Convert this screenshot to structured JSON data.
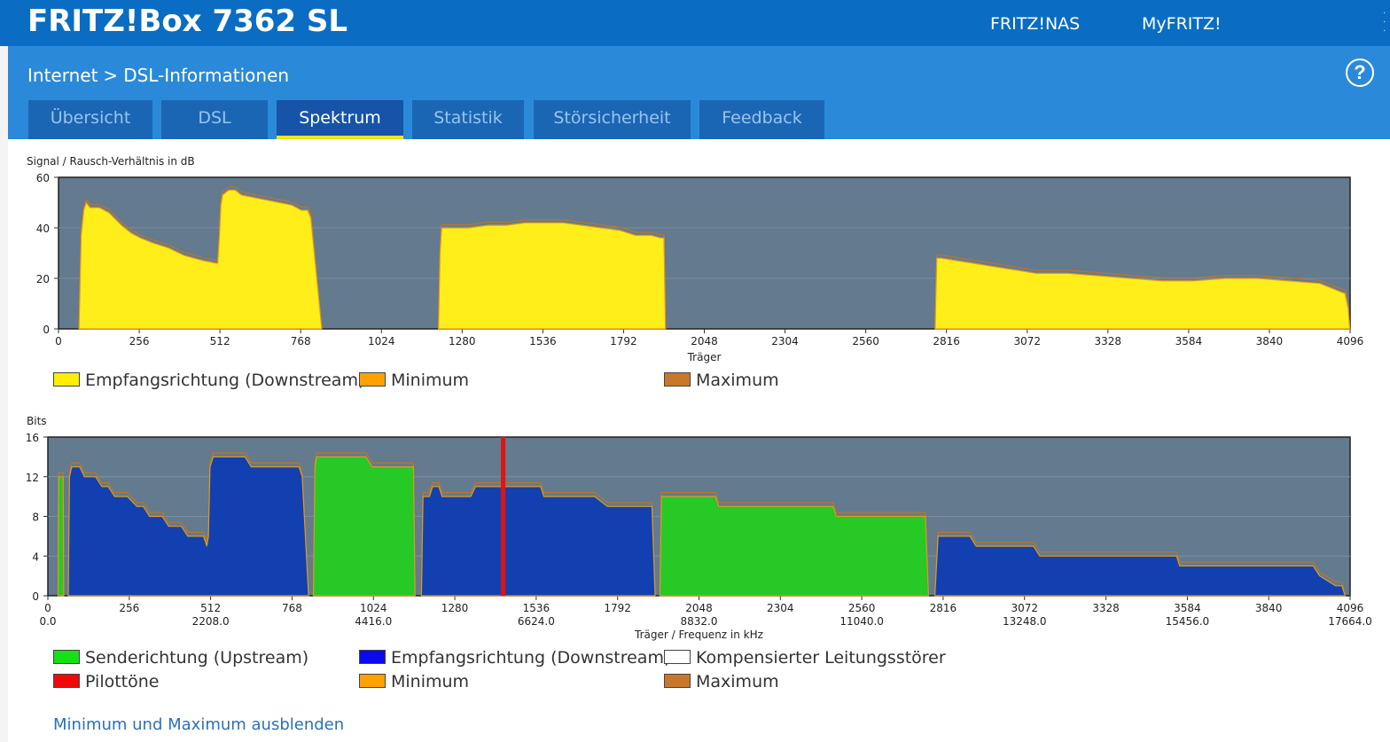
{
  "header": {
    "title": "FRITZ!Box 7362 SL",
    "links": [
      "FRITZ!NAS",
      "MyFRITZ!"
    ]
  },
  "breadcrumb": {
    "parent": "Internet",
    "separator": ">",
    "current": "DSL-Informationen"
  },
  "help": {
    "label": "?"
  },
  "tabs": [
    {
      "label": "Übersicht",
      "active": false
    },
    {
      "label": "DSL",
      "active": false
    },
    {
      "label": "Spektrum",
      "active": true
    },
    {
      "label": "Statistik",
      "active": false
    },
    {
      "label": "Störsicherheit",
      "active": false
    },
    {
      "label": "Feedback",
      "active": false
    }
  ],
  "legend1": [
    {
      "label": "Empfangsrichtung (Downstream)",
      "color": "#ffee00"
    },
    {
      "label": "Minimum",
      "color": "#ffa200"
    },
    {
      "label": "Maximum",
      "color": "#c8782a"
    }
  ],
  "legend2": [
    {
      "label": "Senderichtung (Upstream)",
      "color": "#16e016"
    },
    {
      "label": "Empfangsrichtung (Downstream)",
      "color": "#0a0aee"
    },
    {
      "label": "Kompensierter Leitungsstörer",
      "color": "#ffffff"
    },
    {
      "label": "Pilottöne",
      "color": "#ee0a0a"
    },
    {
      "label": "Minimum",
      "color": "#ffa200"
    },
    {
      "label": "Maximum",
      "color": "#c8782a"
    }
  ],
  "toggle_link": "Minimum und Maximum ausblenden",
  "colors": {
    "plot_bg": "#637a8f",
    "downstream_snr": "#ffee1a",
    "snr_outline": "#e09a1c",
    "upstream_bits": "#26c926",
    "downstream_bits": "#1340b0",
    "pilot": "#e31212",
    "max_outline": "#b8782a"
  },
  "chart_data": [
    {
      "type": "area",
      "ylabel": "Signal / Rausch-Verhältnis in dB",
      "xlabel": "Träger",
      "xlim": [
        0,
        4096
      ],
      "ylim": [
        0,
        60
      ],
      "yticks": [
        0,
        20,
        40,
        60
      ],
      "xticks": [
        0,
        256,
        512,
        768,
        1024,
        1280,
        1536,
        1792,
        2048,
        2304,
        2560,
        2816,
        3072,
        3328,
        3584,
        3840,
        4096
      ],
      "series": [
        {
          "name": "Empfangsrichtung (Downstream)",
          "points": [
            [
              65,
              0
            ],
            [
              72,
              37
            ],
            [
              80,
              47
            ],
            [
              88,
              50
            ],
            [
              100,
              48
            ],
            [
              130,
              48
            ],
            [
              160,
              46
            ],
            [
              200,
              41
            ],
            [
              230,
              38
            ],
            [
              260,
              36
            ],
            [
              300,
              34
            ],
            [
              350,
              32
            ],
            [
              400,
              29
            ],
            [
              460,
              27
            ],
            [
              500,
              26
            ],
            [
              505,
              26
            ],
            [
              510,
              36
            ],
            [
              515,
              49
            ],
            [
              520,
              53
            ],
            [
              540,
              55
            ],
            [
              560,
              55
            ],
            [
              580,
              53
            ],
            [
              620,
              52
            ],
            [
              660,
              51
            ],
            [
              700,
              50
            ],
            [
              740,
              49
            ],
            [
              770,
              47
            ],
            [
              790,
              47
            ],
            [
              800,
              44
            ],
            [
              835,
              0
            ]
          ]
        },
        {
          "name": "Empfangsrichtung (Downstream)",
          "points": [
            [
              1205,
              0
            ],
            [
              1210,
              30
            ],
            [
              1215,
              40
            ],
            [
              1240,
              40
            ],
            [
              1300,
              40
            ],
            [
              1360,
              41
            ],
            [
              1420,
              41
            ],
            [
              1480,
              42
            ],
            [
              1540,
              42
            ],
            [
              1600,
              42
            ],
            [
              1660,
              41
            ],
            [
              1720,
              40
            ],
            [
              1780,
              39
            ],
            [
              1830,
              37
            ],
            [
              1880,
              37
            ],
            [
              1910,
              36
            ],
            [
              1920,
              36
            ],
            [
              1925,
              0
            ]
          ]
        },
        {
          "name": "Empfangsrichtung (Downstream)",
          "points": [
            [
              2780,
              0
            ],
            [
              2785,
              28
            ],
            [
              2800,
              28
            ],
            [
              2850,
              27
            ],
            [
              2900,
              26
            ],
            [
              2950,
              25
            ],
            [
              3000,
              24
            ],
            [
              3050,
              23
            ],
            [
              3100,
              22
            ],
            [
              3200,
              22
            ],
            [
              3300,
              21
            ],
            [
              3400,
              20
            ],
            [
              3500,
              19
            ],
            [
              3600,
              19
            ],
            [
              3700,
              20
            ],
            [
              3800,
              20
            ],
            [
              3900,
              19
            ],
            [
              4000,
              18
            ],
            [
              4060,
              15
            ],
            [
              4080,
              14
            ],
            [
              4090,
              8
            ],
            [
              4095,
              0
            ]
          ]
        }
      ]
    },
    {
      "type": "area",
      "ylabel": "Bits",
      "xlabel": "Träger / Frequenz in kHz",
      "xlim": [
        0,
        4096
      ],
      "ylim": [
        0,
        16
      ],
      "yticks": [
        0,
        4,
        8,
        12,
        16
      ],
      "xticks": [
        0,
        256,
        512,
        768,
        1024,
        1280,
        1536,
        1792,
        2048,
        2304,
        2560,
        2816,
        3072,
        3328,
        3584,
        3840,
        4096
      ],
      "freq_ticks": [
        {
          "carrier": 0,
          "label": "0.0"
        },
        {
          "carrier": 512,
          "label": "2208.0"
        },
        {
          "carrier": 1024,
          "label": "4416.0"
        },
        {
          "carrier": 1536,
          "label": "6624.0"
        },
        {
          "carrier": 2048,
          "label": "8832.0"
        },
        {
          "carrier": 2560,
          "label": "11040.0"
        },
        {
          "carrier": 3072,
          "label": "13248.0"
        },
        {
          "carrier": 3584,
          "label": "15456.0"
        },
        {
          "carrier": 4096,
          "label": "17664.0"
        }
      ],
      "series": [
        {
          "name": "Senderichtung (Upstream)",
          "kind": "up",
          "points": [
            [
              32,
              0
            ],
            [
              34,
              12
            ],
            [
              48,
              12
            ],
            [
              50,
              0
            ]
          ]
        },
        {
          "name": "Empfangsrichtung (Downstream)",
          "kind": "down",
          "points": [
            [
              64,
              0
            ],
            [
              68,
              12
            ],
            [
              75,
              13
            ],
            [
              100,
              13
            ],
            [
              115,
              12
            ],
            [
              150,
              12
            ],
            [
              170,
              11
            ],
            [
              190,
              11
            ],
            [
              210,
              10
            ],
            [
              250,
              10
            ],
            [
              280,
              9
            ],
            [
              300,
              9
            ],
            [
              320,
              8
            ],
            [
              360,
              8
            ],
            [
              380,
              7
            ],
            [
              420,
              7
            ],
            [
              440,
              6
            ],
            [
              490,
              6
            ],
            [
              500,
              5
            ],
            [
              505,
              6
            ],
            [
              510,
              13
            ],
            [
              520,
              14
            ],
            [
              560,
              14
            ],
            [
              620,
              14
            ],
            [
              640,
              13
            ],
            [
              700,
              13
            ],
            [
              760,
              13
            ],
            [
              790,
              13
            ],
            [
              800,
              12
            ],
            [
              820,
              0
            ]
          ]
        },
        {
          "name": "Senderichtung (Upstream)",
          "kind": "up",
          "points": [
            [
              835,
              0
            ],
            [
              840,
              13
            ],
            [
              845,
              14
            ],
            [
              1000,
              14
            ],
            [
              1020,
              13
            ],
            [
              1150,
              13
            ],
            [
              1155,
              0
            ]
          ]
        },
        {
          "name": "Empfangsrichtung (Downstream)",
          "kind": "down",
          "points": [
            [
              1175,
              0
            ],
            [
              1180,
              10
            ],
            [
              1200,
              10
            ],
            [
              1210,
              11
            ],
            [
              1230,
              11
            ],
            [
              1240,
              10
            ],
            [
              1280,
              10
            ],
            [
              1330,
              10
            ],
            [
              1345,
              11
            ],
            [
              1400,
              11
            ],
            [
              1480,
              11
            ],
            [
              1500,
              11
            ],
            [
              1510,
              11
            ],
            [
              1550,
              11
            ],
            [
              1560,
              10
            ],
            [
              1620,
              10
            ],
            [
              1720,
              10
            ],
            [
              1760,
              9
            ],
            [
              1860,
              9
            ],
            [
              1900,
              9
            ],
            [
              1910,
              0
            ]
          ]
        },
        {
          "name": "Senderichtung (Upstream)",
          "kind": "up",
          "points": [
            [
              1925,
              0
            ],
            [
              1930,
              10
            ],
            [
              2000,
              10
            ],
            [
              2100,
              10
            ],
            [
              2110,
              9
            ],
            [
              2200,
              9
            ],
            [
              2300,
              9
            ],
            [
              2400,
              9
            ],
            [
              2470,
              9
            ],
            [
              2480,
              8
            ],
            [
              2600,
              8
            ],
            [
              2700,
              8
            ],
            [
              2760,
              8
            ],
            [
              2770,
              0
            ]
          ]
        },
        {
          "name": "Empfangsrichtung (Downstream)",
          "kind": "down",
          "points": [
            [
              2790,
              0
            ],
            [
              2800,
              6
            ],
            [
              2900,
              6
            ],
            [
              2920,
              5
            ],
            [
              3000,
              5
            ],
            [
              3100,
              5
            ],
            [
              3120,
              4
            ],
            [
              3200,
              4
            ],
            [
              3300,
              4
            ],
            [
              3400,
              4
            ],
            [
              3500,
              4
            ],
            [
              3550,
              4
            ],
            [
              3560,
              3
            ],
            [
              3700,
              3
            ],
            [
              3800,
              3
            ],
            [
              3900,
              3
            ],
            [
              3980,
              3
            ],
            [
              4000,
              2
            ],
            [
              4050,
              1
            ],
            [
              4070,
              1
            ],
            [
              4080,
              0
            ]
          ]
        }
      ],
      "pilot_carrier": 1432
    }
  ]
}
